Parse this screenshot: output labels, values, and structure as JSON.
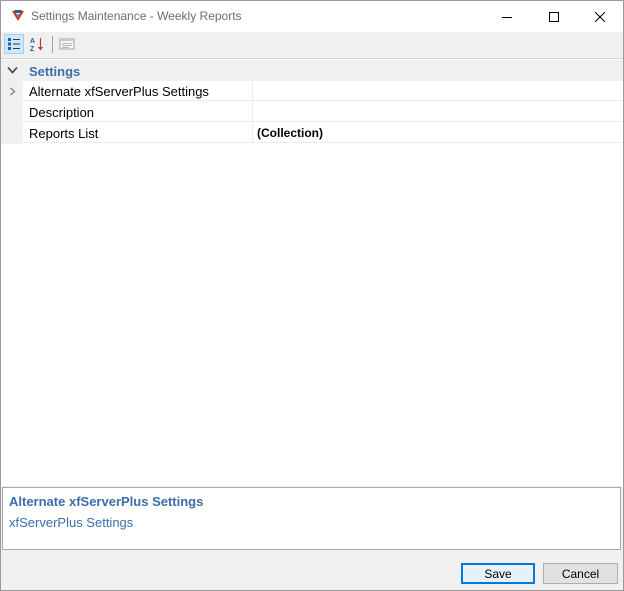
{
  "window": {
    "title": "Settings Maintenance - Weekly Reports"
  },
  "toolbar": {
    "categorized_icon": "categorized-icon",
    "alphabetical_icon": "alphabetical-sort-icon",
    "property_pages_icon": "property-pages-icon"
  },
  "grid": {
    "category": "Settings",
    "properties": [
      {
        "name": "Alternate xfServerPlus Settings",
        "value": "",
        "expandable": true
      },
      {
        "name": "Description",
        "value": "",
        "expandable": false
      },
      {
        "name": "Reports List",
        "value": "(Collection)",
        "expandable": false
      }
    ]
  },
  "description": {
    "title": "Alternate xfServerPlus Settings",
    "text": "xfServerPlus Settings"
  },
  "buttons": {
    "save": "Save",
    "cancel": "Cancel"
  },
  "colors": {
    "accent": "#3c6fa8",
    "focus_border": "#0078d7",
    "toolbar_selected": "#cce8ff"
  }
}
